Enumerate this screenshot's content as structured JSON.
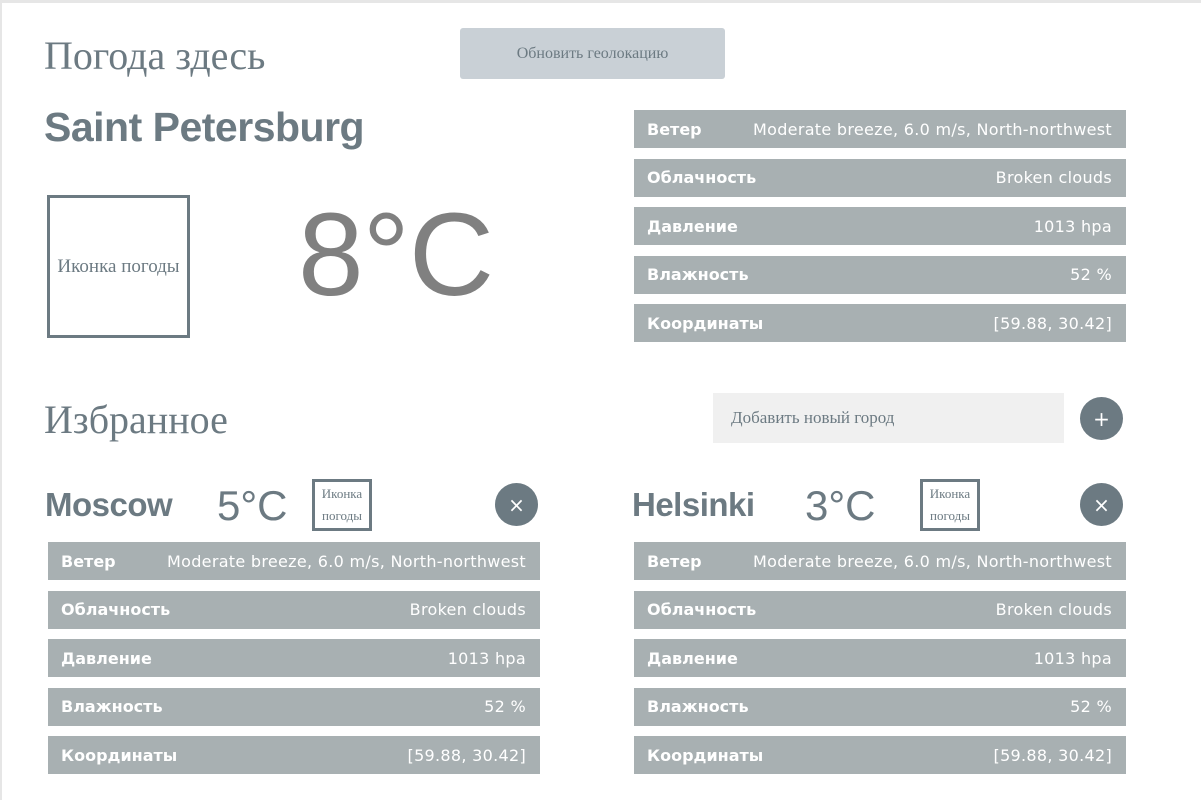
{
  "header": {
    "title": "Погода здесь",
    "geo_button": "Обновить геолокацию"
  },
  "current": {
    "city": "Saint Petersburg",
    "temperature": "8°C",
    "icon_label": "Иконка погоды",
    "details": [
      {
        "label": "Ветер",
        "value": "Moderate breeze, 6.0 m/s, North-northwest"
      },
      {
        "label": "Облачность",
        "value": "Broken clouds"
      },
      {
        "label": "Давление",
        "value": "1013 hpa"
      },
      {
        "label": "Влажность",
        "value": "52 %"
      },
      {
        "label": "Координаты",
        "value": "[59.88, 30.42]"
      }
    ]
  },
  "favorites": {
    "title": "Избранное",
    "add_placeholder": "Добавить новый город",
    "add_button_icon": "+",
    "remove_icon": "×",
    "cities": [
      {
        "city": "Moscow",
        "temperature": "5°C",
        "icon_label": "Иконка погоды",
        "details": [
          {
            "label": "Ветер",
            "value": "Moderate breeze, 6.0 m/s, North-northwest"
          },
          {
            "label": "Облачность",
            "value": "Broken clouds"
          },
          {
            "label": "Давление",
            "value": "1013 hpa"
          },
          {
            "label": "Влажность",
            "value": "52 %"
          },
          {
            "label": "Координаты",
            "value": "[59.88, 30.42]"
          }
        ]
      },
      {
        "city": "Helsinki",
        "temperature": "3°C",
        "icon_label": "Иконка погоды",
        "details": [
          {
            "label": "Ветер",
            "value": "Moderate breeze, 6.0 m/s, North-northwest"
          },
          {
            "label": "Облачность",
            "value": "Broken clouds"
          },
          {
            "label": "Давление",
            "value": "1013 hpa"
          },
          {
            "label": "Влажность",
            "value": "52 %"
          },
          {
            "label": "Координаты",
            "value": "[59.88, 30.42]"
          }
        ]
      }
    ]
  },
  "colors": {
    "accent": "#6c7a82",
    "row_background": "#a8b0b2",
    "button_background": "#c9d0d6",
    "input_background": "#f0f0f0"
  }
}
